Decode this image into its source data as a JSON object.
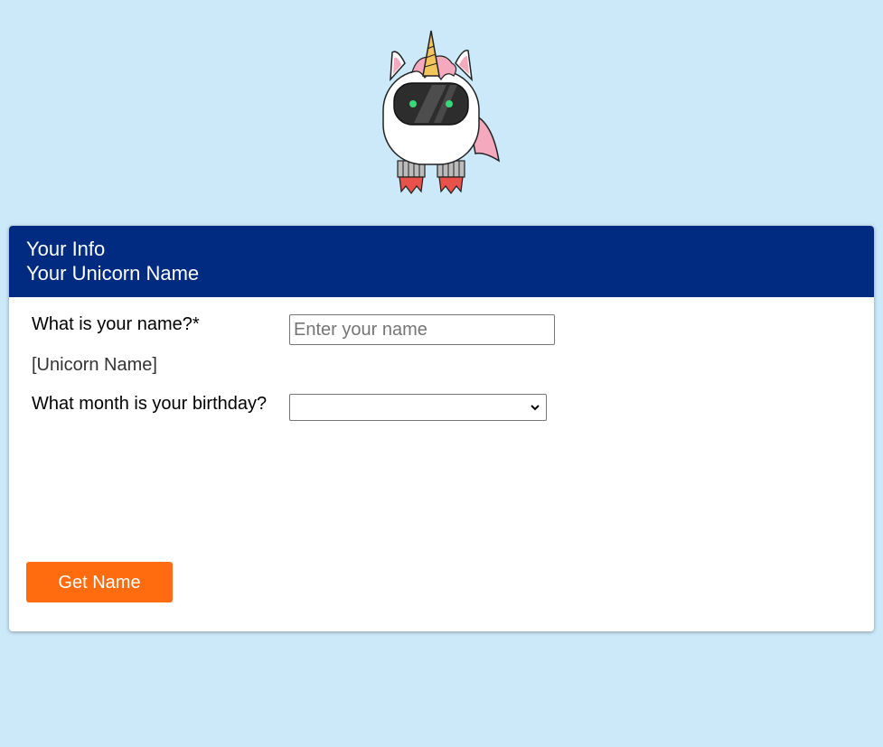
{
  "card": {
    "header": {
      "line1": "Your Info",
      "line2": "Your Unicorn Name"
    }
  },
  "form": {
    "name_label": "What is your name?*",
    "name_placeholder": "Enter your name",
    "name_value": "",
    "result_text": "[Unicorn Name]",
    "month_label": "What month is your birthday?",
    "month_selected": ""
  },
  "actions": {
    "get_name_label": "Get Name"
  },
  "colors": {
    "page_background": "#cce9f9",
    "header_background": "#002b80",
    "button_background": "#ff6b0f"
  },
  "icons": {
    "mascot": "unicorn-robot-icon",
    "select_arrow": "chevron-down-icon"
  }
}
